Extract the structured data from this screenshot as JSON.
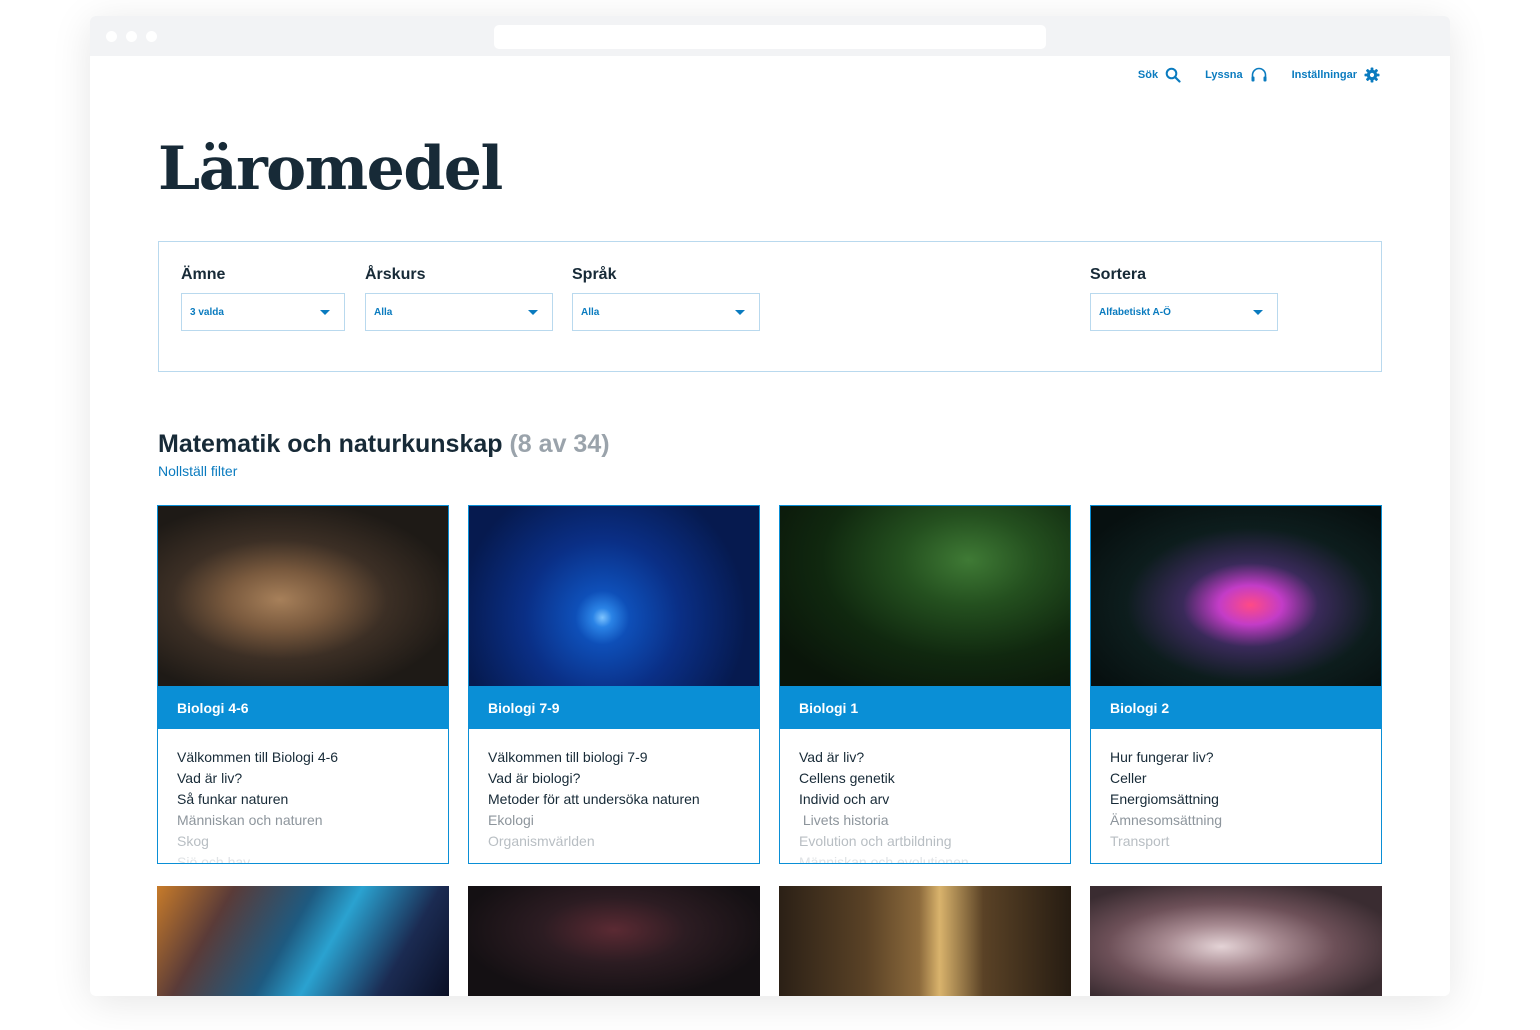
{
  "header": {
    "nav": [
      {
        "label": "Sök",
        "icon": "search-icon"
      },
      {
        "label": "Lyssna",
        "icon": "headphones-icon"
      },
      {
        "label": "Inställningar",
        "icon": "gear-icon"
      }
    ]
  },
  "page": {
    "title": "Läromedel"
  },
  "filters": {
    "subject": {
      "label": "Ämne",
      "value": "3 valda"
    },
    "grade": {
      "label": "Årskurs",
      "value": "Alla"
    },
    "language": {
      "label": "Språk",
      "value": "Alla"
    },
    "sort": {
      "label": "Sortera",
      "value": "Alfabetiskt A-Ö"
    }
  },
  "section": {
    "title": "Matematik och naturkunskap",
    "count": "(8 av 34)",
    "reset_label": "Nollställ filter"
  },
  "cards": [
    {
      "title": "Biologi 4-6",
      "image": "lion-photo",
      "chapters": [
        "Välkommen till Biologi 4-6",
        "Vad är liv?",
        "Så funkar naturen",
        "Människan och naturen",
        "Skog",
        "Sjö och hav"
      ]
    },
    {
      "title": "Biologi 7-9",
      "image": "fish-photo",
      "chapters": [
        "Välkommen till biologi 7-9",
        "Vad är biologi?",
        "Metoder för att undersöka naturen",
        "Ekologi",
        "Organismvärlden"
      ]
    },
    {
      "title": "Biologi 1",
      "image": "leaf-photo",
      "chapters": [
        "Vad är liv?",
        "Cellens genetik",
        "Individ och arv",
        " Livets historia",
        "Evolution och artbildning",
        "Människan och evolutionen"
      ]
    },
    {
      "title": "Biologi 2",
      "image": "smoke-photo",
      "chapters": [
        "Hur fungerar liv?",
        "Celler",
        "Energiomsättning",
        "Ämnesomsättning",
        "Transport"
      ]
    }
  ],
  "tiles": [
    "space-photo",
    "flower-photo",
    "forest-photo",
    "marble-photo"
  ],
  "colors": {
    "accent": "#0a8fd6",
    "link": "#0a7bbf",
    "text": "#172a37"
  }
}
